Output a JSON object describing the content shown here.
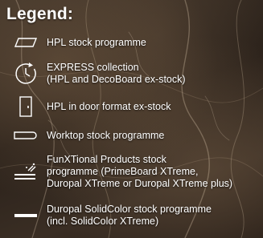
{
  "legend": {
    "title": "Legend:",
    "items": [
      {
        "icon": "hpl-sheet-icon",
        "lines": [
          "HPL stock programme"
        ]
      },
      {
        "icon": "clock-icon",
        "lines": [
          "EXPRESS collection",
          "(HPL and DecoBoard ex-stock)"
        ]
      },
      {
        "icon": "door-icon",
        "lines": [
          "HPL in door format ex-stock"
        ]
      },
      {
        "icon": "worktop-icon",
        "lines": [
          "Worktop stock programme"
        ]
      },
      {
        "icon": "sparkle-board-icon",
        "lines": [
          "FunXTional Products stock",
          "programme (PrimeBoard XTreme,",
          "Duropal XTreme or Duropal XTreme plus)"
        ]
      },
      {
        "icon": "solid-bar-icon",
        "lines": [
          "Duropal SolidColor stock programme",
          "(incl. SolidColor XTreme)"
        ]
      }
    ]
  }
}
